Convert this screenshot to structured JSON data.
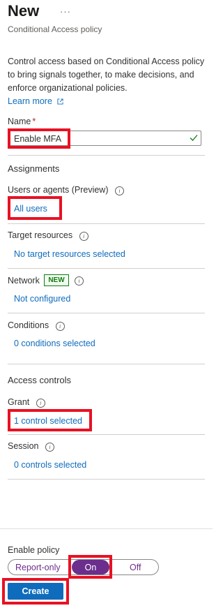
{
  "header": {
    "title": "New",
    "more_label": "···",
    "subtitle": "Conditional Access policy"
  },
  "description": {
    "text": "Control access based on Conditional Access policy to bring signals together, to make decisions, and enforce organizational policies.",
    "learn_more": "Learn more"
  },
  "name_field": {
    "label": "Name",
    "required_mark": "*",
    "value": "Enable MFA"
  },
  "assignments": {
    "heading": "Assignments",
    "users": {
      "label": "Users or agents (Preview)",
      "value": "All users"
    },
    "target_resources": {
      "label": "Target resources",
      "value": "No target resources selected"
    },
    "network": {
      "label": "Network",
      "badge": "NEW",
      "value": "Not configured"
    },
    "conditions": {
      "label": "Conditions",
      "value": "0 conditions selected"
    }
  },
  "access_controls": {
    "heading": "Access controls",
    "grant": {
      "label": "Grant",
      "value": "1 control selected"
    },
    "session": {
      "label": "Session",
      "value": "0 controls selected"
    }
  },
  "enable_policy": {
    "label": "Enable policy",
    "options": [
      "Report-only",
      "On",
      "Off"
    ],
    "selected": "On"
  },
  "footer": {
    "create_label": "Create"
  },
  "colors": {
    "link": "#0f6cbd",
    "toggle_selected": "#6b2e8c",
    "highlight_box": "#e81123",
    "new_badge": "#107c10"
  }
}
